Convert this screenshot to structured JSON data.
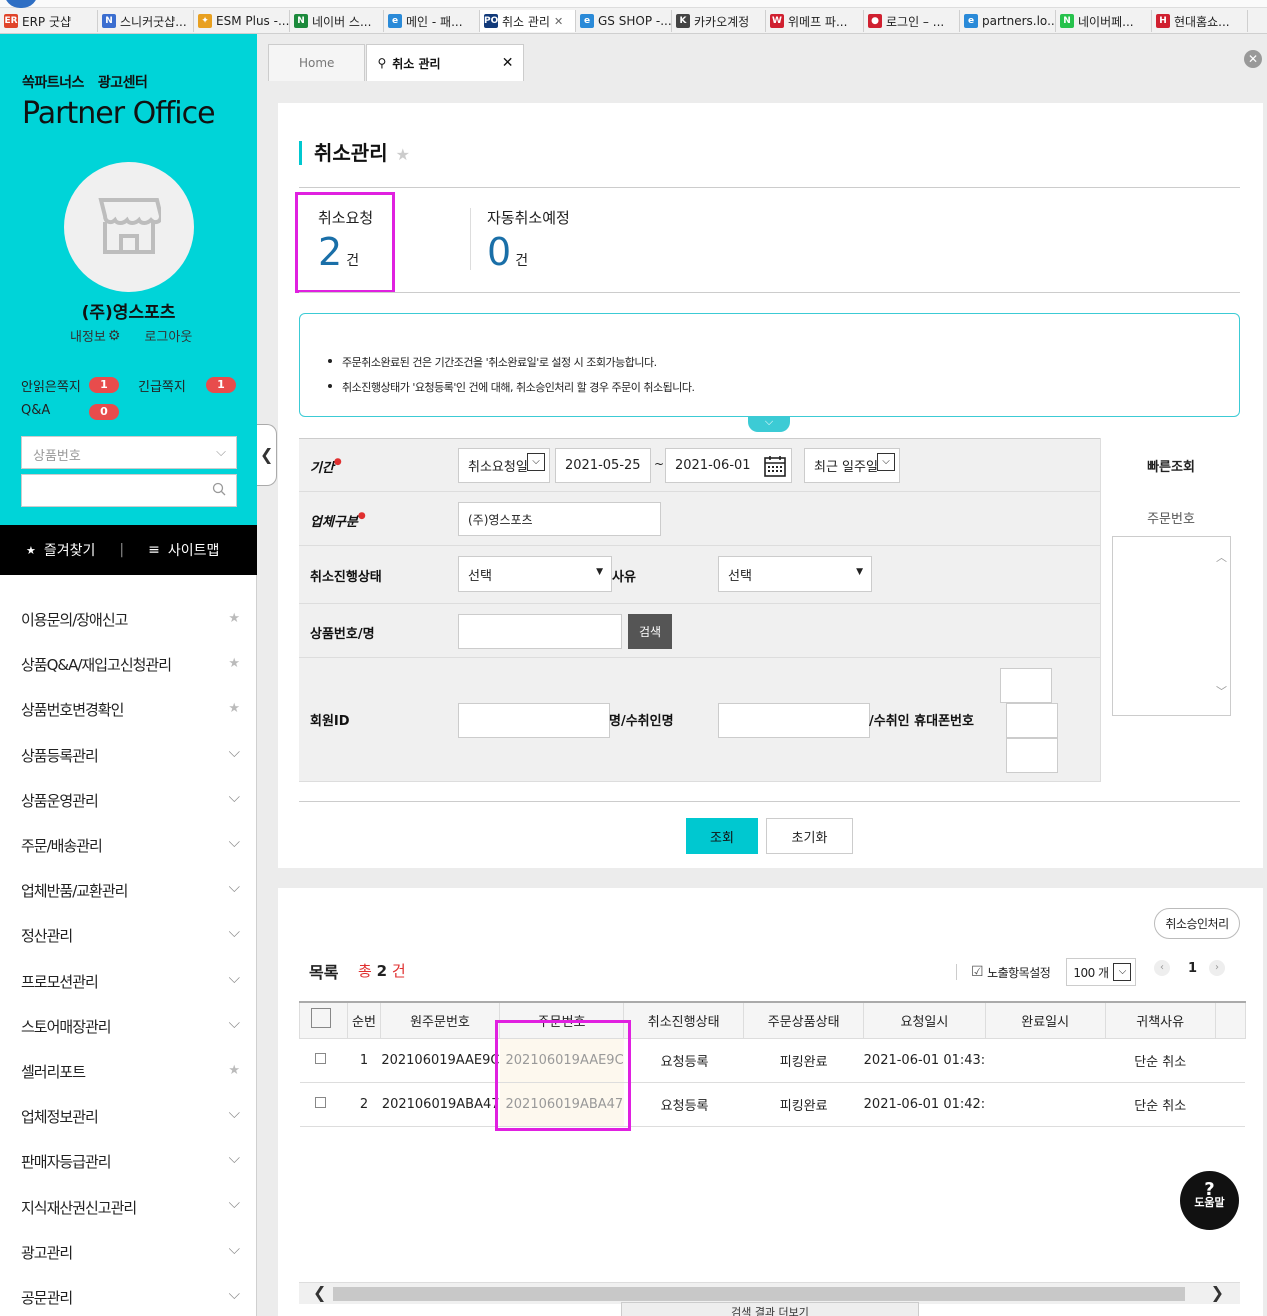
{
  "browser": {
    "tabs": [
      {
        "label": "ERP 굿샵",
        "icon": "ER",
        "color": "#e0442a",
        "width": 98
      },
      {
        "label": "스니커굿샵...",
        "icon": "N",
        "color": "#3b6ed0",
        "width": 96
      },
      {
        "label": "ESM Plus -...",
        "icon": "✦",
        "color": "#e8a020",
        "width": 96
      },
      {
        "label": "네이버 스...",
        "icon": "N",
        "color": "#1c8a3c",
        "width": 94
      },
      {
        "label": "메인 - 패...",
        "icon": "e",
        "color": "#2a8ad8",
        "width": 96
      },
      {
        "label": "취소 관리",
        "icon": "PO",
        "color": "#123a7a",
        "width": 96,
        "active": true
      },
      {
        "label": "GS SHOP -...",
        "icon": "e",
        "color": "#2a8ad8",
        "width": 96
      },
      {
        "label": "카카오계정",
        "icon": "K",
        "color": "#444444",
        "width": 94
      },
      {
        "label": "위메프 파...",
        "icon": "W",
        "color": "#d02030",
        "width": 98
      },
      {
        "label": "로그인 – ...",
        "icon": "●",
        "color": "#d02030",
        "width": 96
      },
      {
        "label": "partners.lo...",
        "icon": "e",
        "color": "#2a8ad8",
        "width": 96
      },
      {
        "label": "네이버페...",
        "icon": "N",
        "color": "#27c24c",
        "width": 96
      },
      {
        "label": "현대홈쇼...",
        "icon": "H",
        "color": "#d02030",
        "width": 96
      }
    ]
  },
  "sidebar": {
    "brand1": "쏙파트너스",
    "brand2": "광고센터",
    "title": "Partner Office",
    "company": "(주)영스포츠",
    "my_info": "내정보",
    "logout": "로그아웃",
    "unread_label": "안읽은쪽지",
    "unread_count": "1",
    "urgent_label": "긴급쪽지",
    "urgent_count": "1",
    "qna_label": "Q&A",
    "qna_count": "0",
    "search_select": "상품번호",
    "favorites": "즐겨찾기",
    "sitemap": "사이트맵",
    "menu": [
      {
        "label": "이용문의/장애신고",
        "mark": "★"
      },
      {
        "label": "상품Q&A/재입고신청관리",
        "mark": "★"
      },
      {
        "label": "상품번호변경확인",
        "mark": "★"
      },
      {
        "label": "상품등록관리",
        "mark": "⌵"
      },
      {
        "label": "상품운영관리",
        "mark": "⌵"
      },
      {
        "label": "주문/배송관리",
        "mark": "⌵"
      },
      {
        "label": "업체반품/교환관리",
        "mark": "⌵"
      },
      {
        "label": "정산관리",
        "mark": "⌵"
      },
      {
        "label": "프로모션관리",
        "mark": "⌵"
      },
      {
        "label": "스토어매장관리",
        "mark": "⌵"
      },
      {
        "label": "셀러리포트",
        "mark": "★"
      },
      {
        "label": "업체정보관리",
        "mark": "⌵"
      },
      {
        "label": "판매자등급관리",
        "mark": "⌵"
      },
      {
        "label": "지식재산권신고관리",
        "mark": "⌵"
      },
      {
        "label": "광고관리",
        "mark": "⌵"
      },
      {
        "label": "공문관리",
        "mark": "⌵"
      }
    ]
  },
  "page_tabs": {
    "home": "Home",
    "current": "취소 관리"
  },
  "page": {
    "title": "취소관리",
    "stat1_label": "취소요청",
    "stat1_value": "2",
    "stat2_label": "자동취소예정",
    "stat2_value": "0",
    "unit": "건",
    "info": [
      "주문취소완료된 건은 기간조건을 '취소완료일'로 설정 시 조회가능합니다.",
      "취소진행상태가 '요청등록'인 건에 대해, 취소승인처리 할 경우 주문이 취소됩니다."
    ]
  },
  "form": {
    "period_label": "기간",
    "period_type": "취소요청일",
    "date_from": "2021-05-25",
    "date_to": "2021-06-01",
    "tilde": "~",
    "period_preset": "최근 일주일",
    "vendor_label": "업체구분",
    "vendor_value": "(주)영스포츠",
    "status_label": "취소진행상태",
    "status_value": "선택",
    "reason_label": "사유",
    "reason_value": "선택",
    "product_label": "상품번호/명",
    "search_btn": "검색",
    "member_label": "회원ID",
    "name_label": "명/수취인명",
    "phone_label": "/수취인 휴대폰번호",
    "quick_title": "빠른조회",
    "quick_label": "주문번호",
    "submit": "조회",
    "reset": "초기화"
  },
  "list": {
    "approve_btn": "취소승인처리",
    "title": "목록",
    "total_prefix": "총",
    "total": "2",
    "total_unit": "건",
    "display_settings": "노출항목설정",
    "page_size": "100 개",
    "page": "1",
    "columns": [
      "순번",
      "원주문번호",
      "주문번호",
      "취소진행상태",
      "주문상품상태",
      "요청일시",
      "완료일시",
      "귀책사유"
    ],
    "rows": [
      [
        "1",
        "202106019AAE9C",
        "202106019AAE9C",
        "요청등록",
        "피킹완료",
        "2021-06-01 01:43:",
        "",
        "단순 취소"
      ],
      [
        "2",
        "202106019ABA47",
        "202106019ABA47",
        "요청등록",
        "피킹완료",
        "2021-06-01 01:42:",
        "",
        "단순 취소"
      ]
    ],
    "help_label": "도움말",
    "help_q": "?",
    "bottom_tab": "검색 결과 더보기"
  }
}
